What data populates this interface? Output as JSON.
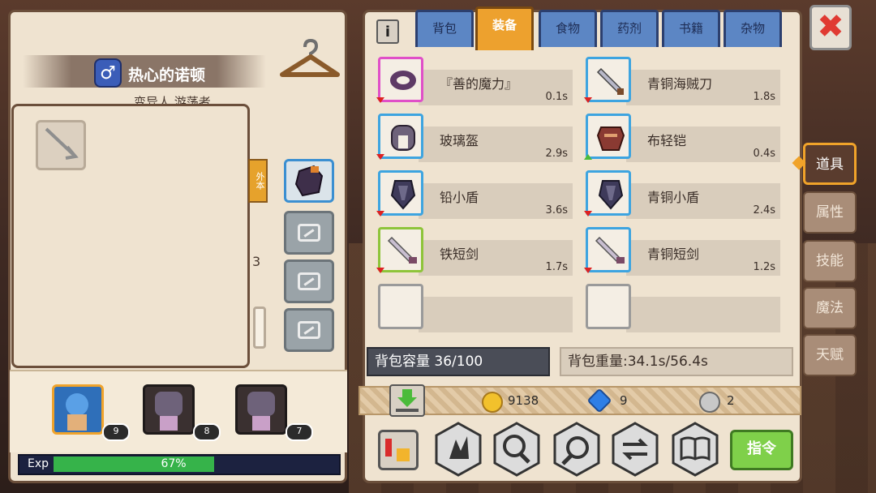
{
  "character": {
    "name": "热心的诺顿",
    "class_line": "变异人 游荡者",
    "gender_symbol": "♂",
    "side_tag": "外本",
    "side_number": "3"
  },
  "party": [
    {
      "level": "9",
      "active": true
    },
    {
      "level": "8",
      "active": false
    },
    {
      "level": "7",
      "active": false
    }
  ],
  "exp": {
    "label": "Exp",
    "percent_text": "67%",
    "percent": 67
  },
  "inventory_tabs": [
    "背包",
    "装备",
    "食物",
    "药剂",
    "书籍",
    "杂物"
  ],
  "active_tab": "装备",
  "info_label": "i",
  "items": [
    {
      "name": "『善的魔力』",
      "weight": "0.1s",
      "frame": "pink",
      "arrow": "down",
      "icon": "ring-icon"
    },
    {
      "name": "青铜海贼刀",
      "weight": "1.8s",
      "frame": "blue",
      "arrow": "down",
      "icon": "sword-icon"
    },
    {
      "name": "玻璃盔",
      "weight": "2.9s",
      "frame": "blue",
      "arrow": "down",
      "icon": "helmet-icon"
    },
    {
      "name": "布轻铠",
      "weight": "0.4s",
      "frame": "blue",
      "arrow": "up",
      "icon": "armor-icon"
    },
    {
      "name": "铅小盾",
      "weight": "3.6s",
      "frame": "blue",
      "arrow": "down",
      "icon": "shield-icon"
    },
    {
      "name": "青铜小盾",
      "weight": "2.4s",
      "frame": "blue",
      "arrow": "down",
      "icon": "shield-icon"
    },
    {
      "name": "铁短剑",
      "weight": "1.7s",
      "frame": "green",
      "arrow": "down",
      "icon": "dagger-icon"
    },
    {
      "name": "青铜短剑",
      "weight": "1.2s",
      "frame": "blue",
      "arrow": "down",
      "icon": "dagger-icon"
    },
    {
      "name": "",
      "weight": "",
      "frame": "grey",
      "arrow": "",
      "icon": "empty-slot"
    },
    {
      "name": "",
      "weight": "",
      "frame": "grey",
      "arrow": "",
      "icon": "empty-slot"
    }
  ],
  "bag": {
    "capacity_text": "背包容量 36/100",
    "weight_text": "背包重量:34.1s/56.4s"
  },
  "currency": {
    "gold": "9138",
    "gems": "9",
    "silver": "2"
  },
  "command_label": "指令",
  "side_tabs": [
    "道具",
    "属性",
    "技能",
    "魔法",
    "天赋"
  ],
  "active_side_tab": "道具",
  "close_label": "✖",
  "colors": {
    "accent": "#eda12e",
    "tab": "#5c86c4",
    "panel": "#efe3d0",
    "exp": "#36b34a"
  }
}
